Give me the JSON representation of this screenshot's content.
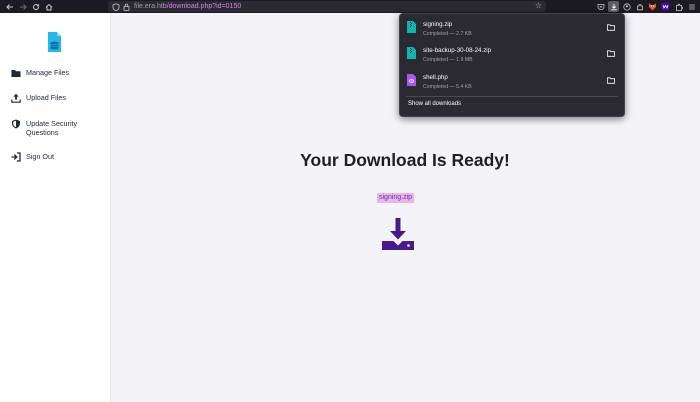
{
  "browser": {
    "url_host": "file.era.htb",
    "url_path": "/download.php?id=0150",
    "nav": {
      "back_icon": "arrow-left-icon",
      "forward_icon": "arrow-right-icon",
      "reload_icon": "reload-icon",
      "home_icon": "home-icon"
    }
  },
  "sidebar": {
    "items": [
      {
        "label": "Manage Files",
        "icon": "folder-icon"
      },
      {
        "label": "Upload Files",
        "icon": "upload-icon"
      },
      {
        "label": "Update Security Questions",
        "icon": "shield-icon"
      },
      {
        "label": "Sign Out",
        "icon": "sign-out-icon"
      }
    ]
  },
  "main": {
    "heading": "Your Download Is Ready!",
    "filename": "signing.zip"
  },
  "downloads_panel": {
    "items": [
      {
        "name": "signing.zip",
        "status": "Completed — 2.7 KB",
        "type": "zip"
      },
      {
        "name": "site-backup-30-08-24.zip",
        "status": "Completed — 1.9 MB",
        "type": "zip"
      },
      {
        "name": "shell.php",
        "status": "Completed — 5.4 KB",
        "type": "php"
      }
    ],
    "show_all": "Show all downloads"
  },
  "colors": {
    "accent_purple": "#4a1a8c",
    "highlight": "#e8b6ec",
    "zip_icon": "#0fb5ae",
    "php_icon": "#a855f7"
  }
}
